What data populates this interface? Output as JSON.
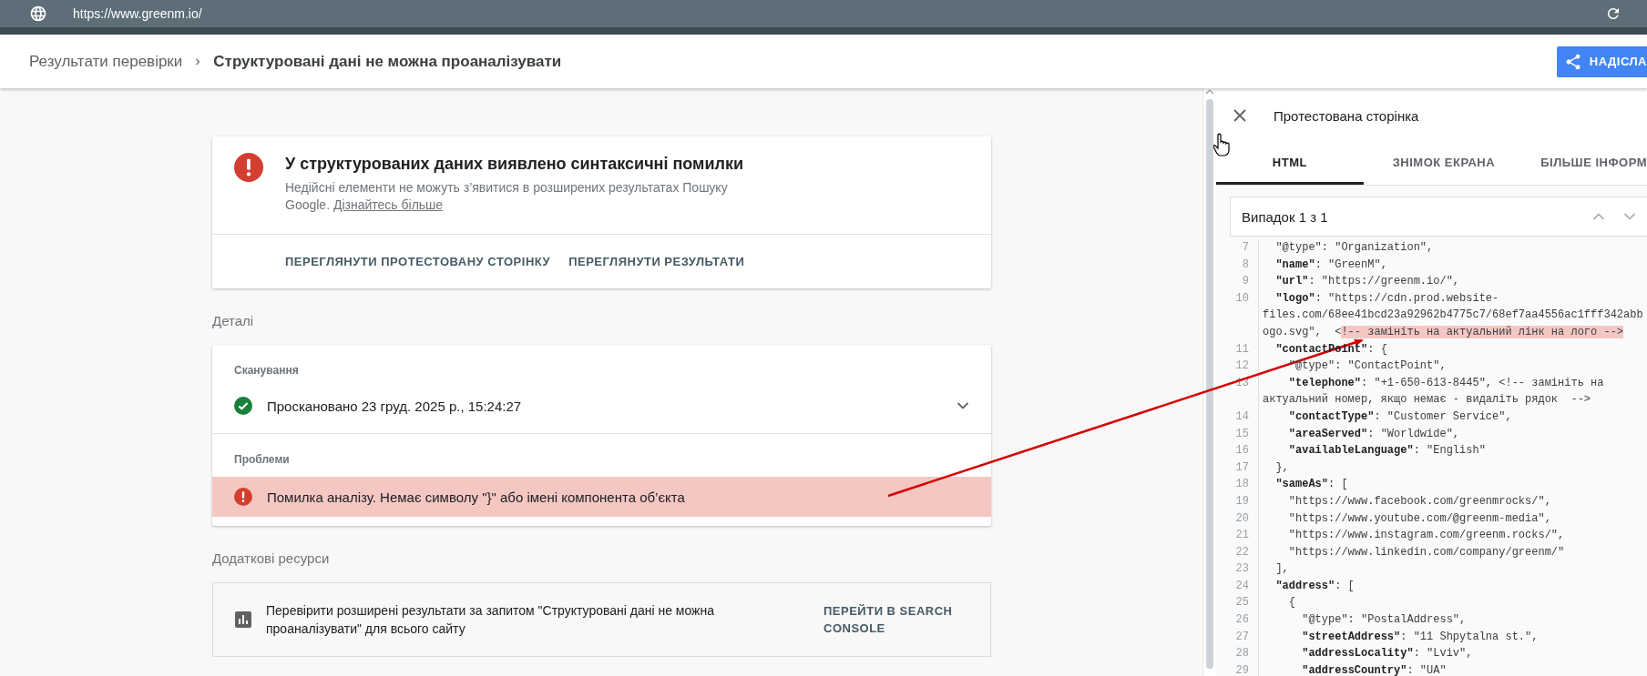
{
  "browser_bar": {
    "url": "https://www.greenm.io/"
  },
  "header": {
    "breadcrumb": [
      {
        "label": "Результати перевірки"
      },
      {
        "label": "Структуровані дані не можна проаналізувати"
      }
    ],
    "submit_button": "НАДІСЛА"
  },
  "summary_card": {
    "title": "У структурованих даних виявлено синтаксичні помилки",
    "description": "Недійсні елементи не можуть з’явитися в розширених результатах Пошуку Google.",
    "link": "Дізнайтесь більше",
    "actions": [
      "ПЕРЕГЛЯНУТИ ПРОТЕСТОВАНУ СТОРІНКУ",
      "ПЕРЕГЛЯНУТИ РЕЗУЛЬТАТИ"
    ]
  },
  "details": {
    "heading": "Деталі",
    "sections": [
      {
        "heading": "Сканування",
        "items": [
          {
            "kind": "success",
            "text": "Проскановано 23 груд. 2025 р., 15:24:27",
            "expanded": false
          }
        ]
      },
      {
        "heading": "Проблеми",
        "items": [
          {
            "kind": "error",
            "text": "Помилка аналізу. Немає символу \"}\" або імені компонента об’єкта",
            "selected": true
          }
        ]
      }
    ]
  },
  "resources": {
    "heading": "Додаткові ресурси",
    "items": [
      {
        "text": "Перевірити розширені результати за запитом \"Структуровані дані не можна проаналізувати\" для всього сайту",
        "action": "ПЕРЕЙТИ В SEARCH CONSOLE"
      }
    ]
  },
  "panel": {
    "title": "Протестована сторінка",
    "tabs": [
      {
        "label": "HTML",
        "selected": true
      },
      {
        "label": "ЗНІМОК ЕКРАНА",
        "selected": false
      },
      {
        "label": "БІЛЬШЕ ІНФОРМ",
        "selected": false
      }
    ],
    "search": {
      "value": "Випадок 1 з 1"
    },
    "code_lines": [
      {
        "number": "7",
        "text": "  \"@type\": \"Organization\","
      },
      {
        "number": "8",
        "text": "  **\"name\"**: \"GreenM\","
      },
      {
        "number": "9",
        "text": "  **\"url\"**: \"https://greenm.io/\","
      },
      {
        "number": "10",
        "text": "  **\"logo\"**: \"https://cdn.prod.website-"
      },
      {
        "text": "files.com/68ee41bcd23a92962b4775c7/68ef7aa4556ac1fff342abb"
      },
      {
        "text": "ogo.svg\",  <",
        "highlight": "!-- замініть на актуальний лінк на лого -->"
      },
      {
        "number": "11",
        "text": "  **\"contactPoint\"**: {"
      },
      {
        "number": "12",
        "text": "    \"@type\": \"ContactPoint\","
      },
      {
        "number": "13",
        "text": "    **\"telephone\"**: \"+1-650-613-8445\", <!-- замініть на"
      },
      {
        "text": "актуальний номер, якщо немає - видаліть рядок  -->"
      },
      {
        "number": "14",
        "text": "    **\"contactType\"**: \"Customer Service\","
      },
      {
        "number": "15",
        "text": "    **\"areaServed\"**: \"Worldwide\","
      },
      {
        "number": "16",
        "text": "    **\"availableLanguage\"**: \"English\""
      },
      {
        "number": "17",
        "text": "  },"
      },
      {
        "number": "18",
        "text": "  **\"sameAs\"**: ["
      },
      {
        "number": "19",
        "text": "    \"https://www.facebook.com/greenmrocks/\","
      },
      {
        "number": "20",
        "text": "    \"https://www.youtube.com/@greenm-media\","
      },
      {
        "number": "21",
        "text": "    \"https://www.instagram.com/greenm.rocks/\","
      },
      {
        "number": "22",
        "text": "    \"https://www.linkedin.com/company/greenm/\""
      },
      {
        "number": "23",
        "text": "  ],"
      },
      {
        "number": "24",
        "text": "  **\"address\"**: ["
      },
      {
        "number": "25",
        "text": "    {"
      },
      {
        "number": "26",
        "text": "      \"@type\": \"PostalAddress\","
      },
      {
        "number": "27",
        "text": "      **\"streetAddress\"**: \"11 Shpytalna st.\","
      },
      {
        "number": "28",
        "text": "      **\"addressLocality\"**: \"Lviv\","
      },
      {
        "number": "29",
        "text": "      **\"addressCountry\"**: \"UA\""
      }
    ]
  }
}
